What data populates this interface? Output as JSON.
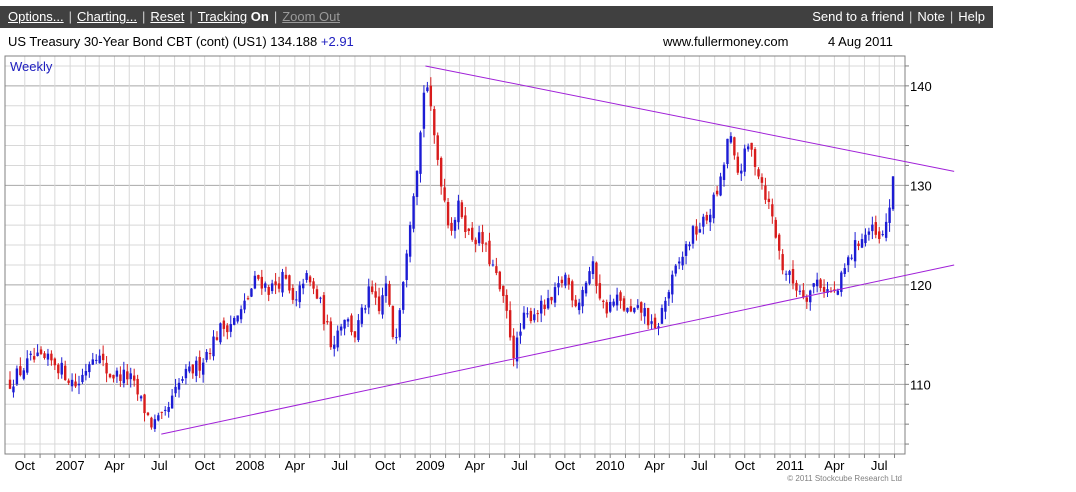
{
  "toolbar": {
    "options": "Options...",
    "charting": "Charting...",
    "reset": "Reset",
    "tracking_label": "Tracking",
    "tracking_state": "On",
    "zoom_out": "Zoom Out",
    "send": "Send to a friend",
    "note": "Note",
    "help": "Help"
  },
  "header": {
    "title": "US Treasury 30-Year  Bond CBT (cont) (US1) 134.188",
    "change": "+2.91",
    "site": "www.fullermoney.com",
    "date": "4 Aug 2011"
  },
  "chart_data": {
    "type": "candlestick",
    "period_label": "Weekly",
    "ylim": [
      103,
      143
    ],
    "y_ticks": [
      110,
      120,
      130,
      140
    ],
    "x_start": "2006-09-01",
    "x_end": "2011-08-04",
    "x_ticks": [
      {
        "label": "Oct",
        "date": "2006-10-01"
      },
      {
        "label": "2007",
        "date": "2007-01-01"
      },
      {
        "label": "Apr",
        "date": "2007-04-01"
      },
      {
        "label": "Jul",
        "date": "2007-07-01"
      },
      {
        "label": "Oct",
        "date": "2007-10-01"
      },
      {
        "label": "2008",
        "date": "2008-01-01"
      },
      {
        "label": "Apr",
        "date": "2008-04-01"
      },
      {
        "label": "Jul",
        "date": "2008-07-01"
      },
      {
        "label": "Oct",
        "date": "2008-10-01"
      },
      {
        "label": "2009",
        "date": "2009-01-01"
      },
      {
        "label": "Apr",
        "date": "2009-04-01"
      },
      {
        "label": "Jul",
        "date": "2009-07-01"
      },
      {
        "label": "Oct",
        "date": "2009-10-01"
      },
      {
        "label": "2010",
        "date": "2010-01-01"
      },
      {
        "label": "Apr",
        "date": "2010-04-01"
      },
      {
        "label": "Jul",
        "date": "2010-07-01"
      },
      {
        "label": "Oct",
        "date": "2010-10-01"
      },
      {
        "label": "2011",
        "date": "2011-01-01"
      },
      {
        "label": "Apr",
        "date": "2011-04-01"
      },
      {
        "label": "Jul",
        "date": "2011-07-01"
      }
    ],
    "close_path": [
      [
        "2006-09-01",
        110.2
      ],
      [
        "2006-10-15",
        112.5
      ],
      [
        "2006-12-01",
        112.2
      ],
      [
        "2007-01-15",
        109.8
      ],
      [
        "2007-02-20",
        113.5
      ],
      [
        "2007-03-20",
        111.0
      ],
      [
        "2007-05-01",
        110.8
      ],
      [
        "2007-06-15",
        106.0
      ],
      [
        "2007-07-10",
        106.5
      ],
      [
        "2007-08-15",
        110.5
      ],
      [
        "2007-09-20",
        112.0
      ],
      [
        "2007-11-01",
        115.5
      ],
      [
        "2007-12-10",
        116.8
      ],
      [
        "2008-01-15",
        120.8
      ],
      [
        "2008-02-10",
        119.5
      ],
      [
        "2008-03-10",
        120.8
      ],
      [
        "2008-04-01",
        117.5
      ],
      [
        "2008-04-20",
        121.0
      ],
      [
        "2008-05-20",
        118.5
      ],
      [
        "2008-06-15",
        114.0
      ],
      [
        "2008-07-10",
        117.0
      ],
      [
        "2008-08-01",
        115.0
      ],
      [
        "2008-09-01",
        119.5
      ],
      [
        "2008-09-20",
        117.0
      ],
      [
        "2008-10-01",
        120.5
      ],
      [
        "2008-10-20",
        114.0
      ],
      [
        "2008-11-05",
        120.0
      ],
      [
        "2008-11-25",
        128.5
      ],
      [
        "2008-12-10",
        134.0
      ],
      [
        "2008-12-22",
        141.5
      ],
      [
        "2009-01-05",
        136.0
      ],
      [
        "2009-01-25",
        130.0
      ],
      [
        "2009-02-10",
        125.5
      ],
      [
        "2009-03-01",
        128.0
      ],
      [
        "2009-03-20",
        125.0
      ],
      [
        "2009-04-15",
        124.5
      ],
      [
        "2009-05-10",
        121.5
      ],
      [
        "2009-06-05",
        117.0
      ],
      [
        "2009-06-20",
        113.0
      ],
      [
        "2009-07-10",
        116.5
      ],
      [
        "2009-08-05",
        117.5
      ],
      [
        "2009-09-01",
        118.0
      ],
      [
        "2009-10-01",
        121.0
      ],
      [
        "2009-10-25",
        118.0
      ],
      [
        "2009-11-25",
        122.0
      ],
      [
        "2009-12-20",
        117.5
      ],
      [
        "2010-01-15",
        118.5
      ],
      [
        "2010-02-10",
        117.0
      ],
      [
        "2010-03-10",
        117.5
      ],
      [
        "2010-04-01",
        115.0
      ],
      [
        "2010-04-20",
        118.0
      ],
      [
        "2010-05-15",
        121.5
      ],
      [
        "2010-06-15",
        125.0
      ],
      [
        "2010-07-15",
        126.5
      ],
      [
        "2010-08-15",
        130.5
      ],
      [
        "2010-08-30",
        135.5
      ],
      [
        "2010-09-15",
        131.0
      ],
      [
        "2010-10-10",
        134.0
      ],
      [
        "2010-11-01",
        131.0
      ],
      [
        "2010-11-25",
        127.0
      ],
      [
        "2010-12-15",
        122.0
      ],
      [
        "2011-01-10",
        120.0
      ],
      [
        "2011-02-05",
        119.0
      ],
      [
        "2011-02-25",
        120.5
      ],
      [
        "2011-03-15",
        119.5
      ],
      [
        "2011-04-05",
        119.0
      ],
      [
        "2011-04-25",
        122.0
      ],
      [
        "2011-05-20",
        124.5
      ],
      [
        "2011-06-15",
        125.5
      ],
      [
        "2011-07-05",
        124.0
      ],
      [
        "2011-07-20",
        127.5
      ],
      [
        "2011-08-01",
        131.0
      ],
      [
        "2011-08-04",
        134.2
      ]
    ],
    "trendlines": [
      {
        "name": "upper resistance",
        "from": [
          "2008-12-22",
          142.0
        ],
        "to": [
          "2011-11-30",
          131.4
        ]
      },
      {
        "name": "lower support",
        "from": [
          "2007-07-05",
          105.0
        ],
        "to": [
          "2011-11-30",
          122.0
        ]
      }
    ],
    "colors": {
      "up": "#1c1cd4",
      "down": "#d81c1c",
      "trendline": "#a020d8",
      "grid": "#d8d8d8"
    },
    "grid": true
  },
  "copyright": "© 2011 Stockcube Research Ltd"
}
